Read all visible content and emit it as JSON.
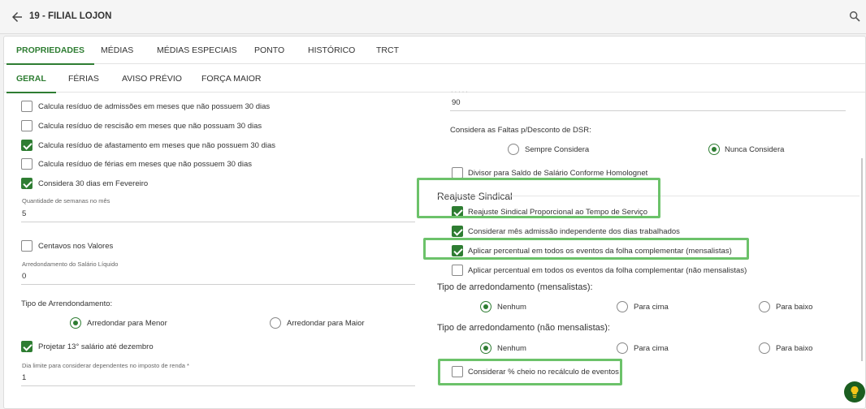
{
  "header": {
    "title": "19 - FILIAL LOJON"
  },
  "tabs_main": [
    "PROPRIEDADES",
    "MÉDIAS",
    "MÉDIAS ESPECIAIS",
    "PONTO",
    "HISTÓRICO",
    "TRCT"
  ],
  "tabs_sub": [
    "GERAL",
    "FÉRIAS",
    "AVISO PRÉVIO",
    "FORÇA MAIOR"
  ],
  "left": {
    "cb_adm": "Calcula resíduo de admissões em meses que não possuem 30 dias",
    "cb_resc": "Calcula resíduo de rescisão em meses que não possuam 30 dias",
    "cb_afast": "Calcula resíduo de afastamento em meses que não possuem 30 dias",
    "cb_ferias": "Calcula resíduo de férias em meses que não possuem 30 dias",
    "cb_fev": "Considera 30 dias em Fevereiro",
    "semanas_label": "Quantidade de semanas no mês",
    "semanas_value": "5",
    "cb_centavos": "Centavos nos Valores",
    "arred_label": "Arredondamento do Salário Líquido",
    "arred_value": "0",
    "tipo_arred_label": "Tipo de Arrendondamento:",
    "radio_menor": "Arredondar para Menor",
    "radio_maior": "Arredondar para Maior",
    "cb_13": "Projetar 13° salário até dezembro",
    "dia_limite_label": "Dia limite para considerar dependentes no imposto de renda *",
    "dia_limite_value": "1"
  },
  "right": {
    "top_value": "90",
    "faltas_label": "Considera as Faltas p/Desconto de DSR:",
    "radio_sempre": "Sempre Considera",
    "radio_nunca": "Nunca Considera",
    "cb_divisor": "Divisor para Saldo de Salário Conforme Homolognet",
    "reajuste_heading": "Reajuste Sindical",
    "cb_reaj_prop": "Reajuste Sindical Proporcional ao Tempo de Serviço",
    "cb_mes_adm": "Considerar mês admissão independente dos dias trabalhados",
    "cb_perc_mens": "Aplicar percentual em todos os eventos da folha complementar (mensalistas)",
    "cb_perc_nao_mens": "Aplicar percentual em todos os eventos da folha complementar (não mensalistas)",
    "tipo_mens_heading": "Tipo de arredondamento (mensalistas):",
    "tipo_nao_mens_heading": "Tipo de arredondamento (não mensalistas):",
    "opt_nenhum": "Nenhum",
    "opt_cima": "Para cima",
    "opt_baixo": "Para baixo",
    "cb_cheio": "Considerar % cheio no recálculo de eventos"
  },
  "colors": {
    "accent": "#2e7d32",
    "highlight": "#6cc26a"
  },
  "icons": {
    "back": "arrow-left-icon",
    "search": "search-icon",
    "help": "lightbulb-icon"
  }
}
